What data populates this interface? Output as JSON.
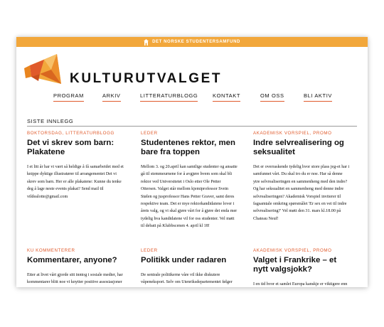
{
  "topbar": {
    "text": "DET NORSKE STUDENTERSAMFUND",
    "color": "#f2a73b"
  },
  "brand": {
    "name": "KULTURUTVALGET",
    "logo": "megaphone-logo",
    "accent": "#e05a2b"
  },
  "nav": {
    "items": [
      {
        "label": "PROGRAM"
      },
      {
        "label": "ARKIV"
      },
      {
        "label": "LITTERATURBLOGG"
      },
      {
        "label": "KONTAKT"
      },
      {
        "label": "OM OSS"
      },
      {
        "label": "BLI AKTIV"
      }
    ]
  },
  "section": {
    "title": "SISTE INNLEGG"
  },
  "posts": [
    {
      "category": "BOKTORSDAG, LITTERATURBLOGG",
      "title": "Det vi skrev som barn: Plakatene",
      "body": "I et litt år har vi vært så heldige å få samarbeidet med et knippe dyktige illustratører til arrangementet Det vi skrev som barn.  Her er alle plakatene: Kunne du tenke deg å lage neste events plakat? Send mail til vildealotte@gmail.com"
    },
    {
      "category": "LEDER",
      "title": "Studentenes rektor, men bare fra toppen",
      "body": "Mellom 3. og 20.april kan samtlige studenter og ansatte gå til stemmeurnene for å avgjøre hvem som skal bli rektor ved Universitetet i Oslo etter Ole Petter Ottersen. Valget står mellom kjemiprofessor Svein Stølen og jusprofessor Hans Petter Graver, samt deres respektive team. Det er mye rektorkandidatene lover i årets valg, og vi skal gjøre vårt for å gjøre det enda mer tydelig hva kandidatene vil for oss studenter. Vel møtt til debatt på Klubbscenen 4. april kl 18!"
    },
    {
      "category": "AKADEMISK VORSPIEL, PROMO",
      "title": "Indre selvrealisering og seksualitet",
      "body": "Det er overraskende tydelig hvor store plass jeg-et har i samfunnet vårt. Du skal tro du er noe. Har så denne ytre selvrealiseringen en sammenheng med den indre? Og har seksualitet en sammenheng med denne indre selvrealiseringen? Akademisk Vorspiel inviterer til fagsamtale omkring spørsmålet 'Er sex en vei til indre selvrealisering?' Vel møtt den 31. mars kl.18.00 på Chateau Neuf!"
    },
    {
      "category": "KU KOMMENTERER",
      "title": "Kommentarer, anyone?",
      "body": "Etter at livet vårt gjorde sitt inntog i sosiale medier, har kommentarer blitt noe vi knytter positive assosiasjoner til. Gjelder det samme på andre plattformer?"
    },
    {
      "category": "LEDER",
      "title": "Politikk under radaren",
      "body": "De sentrale politikerne våre vil ikke diskutere våpeneksport. Selv om Utenriksdepartementet følger strenge retningslinjer når de behandler søknader om eksport."
    },
    {
      "category": "AKADEMISK VORSPIEL, PROMO",
      "title": "Valget i Frankrike – et nytt valgsjokk?",
      "body": "I en tid hvor et samlet Europa kanskje er viktigere enn noensinne, står Frankrike foran et valg."
    }
  ]
}
